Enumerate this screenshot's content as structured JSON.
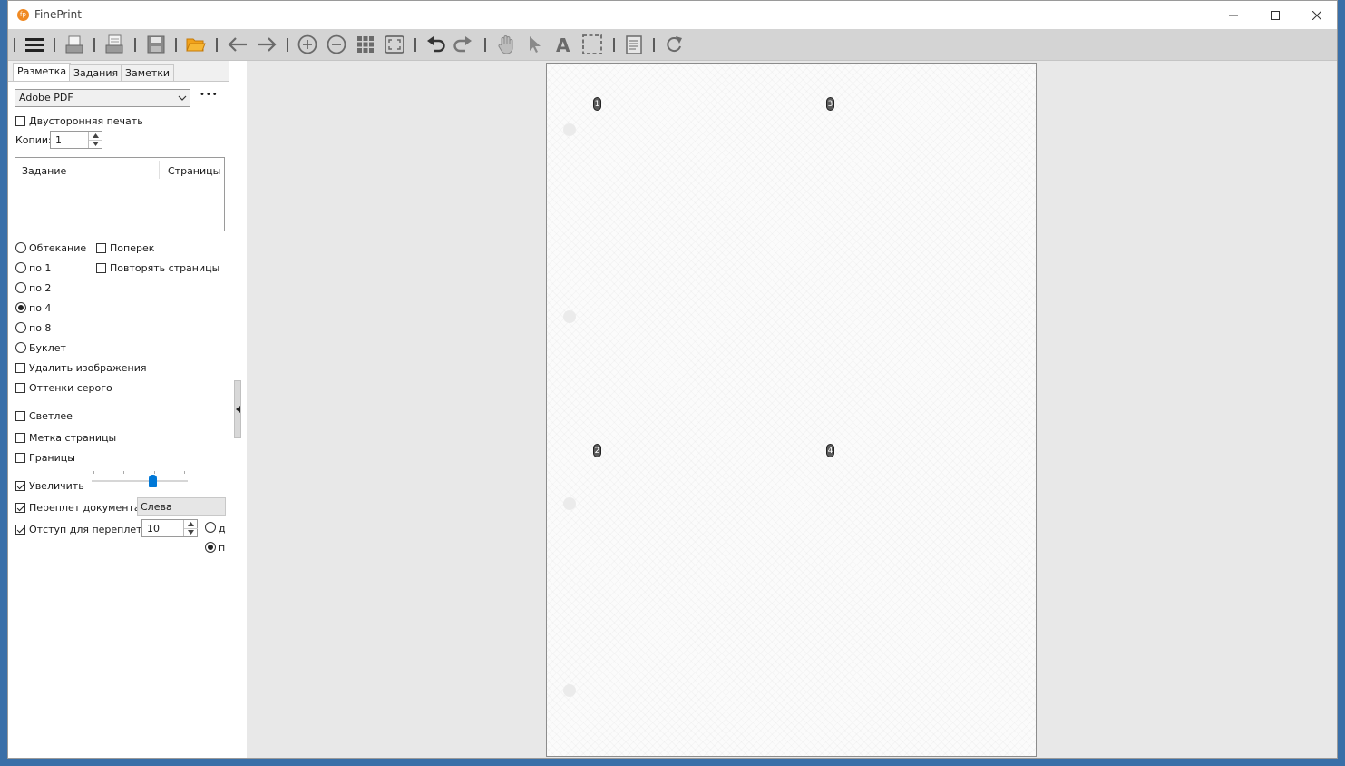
{
  "window": {
    "title": "FinePrint",
    "app_icon_text": "fp",
    "controls": [
      "minimize",
      "maximize",
      "close"
    ]
  },
  "toolbar": {
    "icons": [
      "menu-icon",
      "print-icon",
      "print-properties-icon",
      "save-icon",
      "open-folder-icon",
      "back-arrow-icon",
      "forward-arrow-icon",
      "zoom-in-icon",
      "zoom-out-icon",
      "grid-view-icon",
      "fit-page-icon",
      "undo-icon",
      "redo-icon",
      "hand-icon",
      "pointer-icon",
      "text-icon",
      "select-area-icon",
      "page-settings-icon",
      "refresh-icon"
    ]
  },
  "tabs": [
    "Разметка",
    "Задания",
    "Заметки"
  ],
  "printer": {
    "selected": "Adobe PDF",
    "more_label": "•••"
  },
  "duplex": {
    "label": "Двусторонняя печать",
    "checked": false
  },
  "copies": {
    "label": "Копии:",
    "value": "1"
  },
  "jobs_table": {
    "columns": [
      "Задание",
      "Страницы"
    ],
    "rows": []
  },
  "layout_options": [
    {
      "label": "Обтекание",
      "selected": false
    },
    {
      "label": "по 1",
      "selected": false
    },
    {
      "label": "по 2",
      "selected": false
    },
    {
      "label": "по 4",
      "selected": true
    },
    {
      "label": "по 8",
      "selected": false
    },
    {
      "label": "Буклет",
      "selected": false
    }
  ],
  "right_checks": [
    {
      "label": "Поперек",
      "checked": false
    },
    {
      "label": "Повторять страницы",
      "checked": false
    }
  ],
  "options": [
    {
      "label": "Удалить изображения",
      "checked": false
    },
    {
      "label": "Оттенки серого",
      "checked": false
    },
    {
      "label": "Светлее",
      "checked": false
    },
    {
      "label": "Метка страницы",
      "checked": false
    },
    {
      "label": "Границы",
      "checked": false
    }
  ],
  "enlarge": {
    "label": "Увеличить",
    "checked": true,
    "level": 0.65
  },
  "binding": {
    "label": "Переплет документа",
    "checked": true,
    "value": "Слева"
  },
  "gutter": {
    "label": "Отступ для переплета",
    "checked": true,
    "value": "10",
    "unit_options": [
      "д",
      "п"
    ],
    "unit_selected": "п"
  },
  "preview": {
    "page_numbers": [
      "1",
      "3",
      "2",
      "4"
    ]
  },
  "colors": {
    "accent": "#0078d7",
    "orange": "#e88a1a",
    "toolbar_bg": "#d4d4d4"
  }
}
